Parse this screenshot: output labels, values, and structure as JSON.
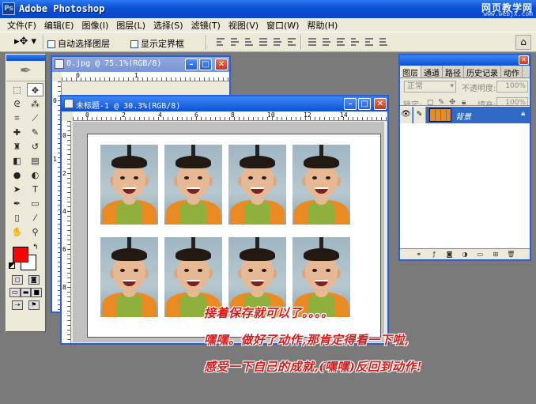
{
  "app": {
    "title": "Adobe Photoshop",
    "site_logo_line1": "网页教学网",
    "site_logo_line2": "www.webjx.com"
  },
  "menu": [
    "文件(F)",
    "编辑(E)",
    "图像(I)",
    "图层(L)",
    "选择(S)",
    "滤镜(T)",
    "视图(V)",
    "窗口(W)",
    "帮助(H)"
  ],
  "options": {
    "auto_select_layer": "自动选择图层",
    "show_bounding_box": "显示定界框",
    "auto_select_checked": false,
    "show_bounding_checked": false
  },
  "toolbox": {
    "foreground_color": "#ff0000",
    "background_color": "#ffffff",
    "tools": [
      "marquee-icon",
      "move-icon",
      "lasso-icon",
      "magic-wand-icon",
      "crop-icon",
      "slice-icon",
      "healing-brush-icon",
      "brush-icon",
      "clone-stamp-icon",
      "history-brush-icon",
      "eraser-icon",
      "gradient-icon",
      "blur-icon",
      "dodge-icon",
      "path-select-icon",
      "type-icon",
      "pen-icon",
      "shape-icon",
      "notes-icon",
      "eyedropper-icon",
      "hand-icon",
      "zoom-icon"
    ]
  },
  "documents": {
    "back": {
      "title": "0.jpg @ 75.1%(RGB/8)",
      "ruler_h": [
        "0",
        "1"
      ],
      "ruler_v": [
        "0",
        "1"
      ]
    },
    "front": {
      "title": "未标题-1 @ 30.3%(RGB/8)",
      "ruler_h": [
        "0",
        "2",
        "4",
        "6",
        "8",
        "10",
        "12",
        "14"
      ],
      "ruler_v": [
        "0",
        "2",
        "4",
        "6",
        "8"
      ],
      "photo_count": 8
    }
  },
  "layers_palette": {
    "tabs": [
      "图层",
      "通道",
      "路径",
      "历史记录",
      "动作"
    ],
    "blend_mode": "正常",
    "opacity_label": "不透明度:",
    "opacity_value": "100%",
    "lock_label": "锁定:",
    "fill_label": "填充:",
    "fill_value": "100%",
    "layer_name": "背景"
  },
  "annotations": [
    "接着保存就可以了。。。。",
    "嘿嘿。做好了动作,那肯定得看一下啦,",
    "感受一下自己的成就,(嘿嘿)反回到动作!"
  ],
  "colors": {
    "titlebar_blue": "#0a4fd6",
    "annotation_red": "#d51a1a",
    "selected_layer": "#316ac5",
    "workspace_gray": "#7a7a7a"
  }
}
